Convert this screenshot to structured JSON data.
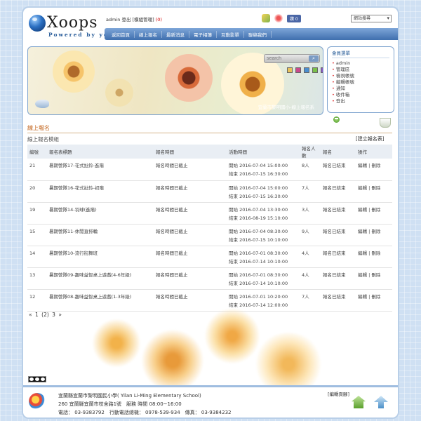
{
  "header": {
    "logo_text": "Xoops",
    "logo_sub": "Powered by you",
    "user": "admin",
    "logout": "登出",
    "admin_link": "[模組管理]",
    "count": "(0)",
    "like": "讚 0",
    "site_select": "網站搜尋"
  },
  "nav": [
    "返回首頁",
    "線上報名",
    "最新消息",
    "電子相簿",
    "互動影單",
    "聯絡我們"
  ],
  "banner": {
    "search_placeholder": "search",
    "caption": "宜蘭市黎明國小-線上報名系",
    "swatch_colors": [
      "#e8c25a",
      "#c94a8b",
      "#4a8fd1",
      "#7ac04a",
      "#8a5ac4"
    ]
  },
  "sidebar": {
    "title": "會員選單",
    "items": [
      "admin",
      "管理區",
      "檢視帳號",
      "編輯帳號",
      "通知",
      "收件箱",
      "登出"
    ]
  },
  "module": {
    "title": "線上報名",
    "subheading": "線上報名模組",
    "create_link": "[建立報名表]"
  },
  "table": {
    "headers": [
      "編號",
      "報名表標題",
      "報名時間",
      "活動時間",
      "報名人數",
      "報名",
      "操作"
    ],
    "rows": [
      {
        "id": "21",
        "title": "暑期營隊17-花式扯鈴-進階",
        "reg": "報名時間已截止",
        "start": "開始 2016-07-04 15:00:00",
        "end": "結束 2016-07-15 16:30:00",
        "count": "8人",
        "status": "報名已結束",
        "ops": "編輯 | 刪除"
      },
      {
        "id": "20",
        "title": "暑期營隊16-花式扯鈴-初階",
        "reg": "報名時間已截止",
        "start": "開始 2016-07-04 15:00:00",
        "end": "結束 2016-07-15 16:30:00",
        "count": "7人",
        "status": "報名已結束",
        "ops": "編輯 | 刪除"
      },
      {
        "id": "19",
        "title": "暑期營隊14-羽球(進階)",
        "reg": "報名時間已截止",
        "start": "開始 2016-07-04 13:30:00",
        "end": "結束 2016-08-19 15:10:00",
        "count": "3人",
        "status": "報名已結束",
        "ops": "編輯 | 刪除"
      },
      {
        "id": "15",
        "title": "暑期營隊11-休閒直排輪",
        "reg": "報名時間已截止",
        "start": "開始 2016-07-04 08:30:00",
        "end": "結束 2016-07-15 10:10:00",
        "count": "9人",
        "status": "報名已結束",
        "ops": "編輯 | 刪除"
      },
      {
        "id": "14",
        "title": "暑期營隊10-流行街舞班",
        "reg": "報名時間已截止",
        "start": "開始 2016-07-01 08:30:00",
        "end": "結束 2016-07-14 10:10:00",
        "count": "4人",
        "status": "報名已結束",
        "ops": "編輯 | 刪除"
      },
      {
        "id": "13",
        "title": "暑期營隊09-趣味益智桌上遊戲(4-6年級)",
        "reg": "報名時間已截止",
        "start": "開始 2016-07-01 08:30:00",
        "end": "結束 2016-07-14 10:10:00",
        "count": "4人",
        "status": "報名已結束",
        "ops": "編輯 | 刪除"
      },
      {
        "id": "12",
        "title": "暑期營隊08-趣味益智桌上遊戲(1-3年級)",
        "reg": "報名時間已截止",
        "start": "開始 2016-07-01 10:20:00",
        "end": "結束 2016-07-14 12:00:00",
        "count": "7人",
        "status": "報名已結束",
        "ops": "編輯 | 刪除"
      }
    ]
  },
  "pager": [
    "«",
    "1",
    "(2)",
    "3",
    "»"
  ],
  "footer": {
    "line1": "宜蘭縣宜蘭市黎明國民小學( Yilan Li-Ming Elementary School)",
    "line2": "260 宜蘭縣宜蘭市校舍路1號　服務 時間 08:00~16:00",
    "line3": "電話： 03-9383792　行動電話總機： 0978-539-934　傳真： 03-9384232",
    "edit": "[編輯頁腳]"
  }
}
